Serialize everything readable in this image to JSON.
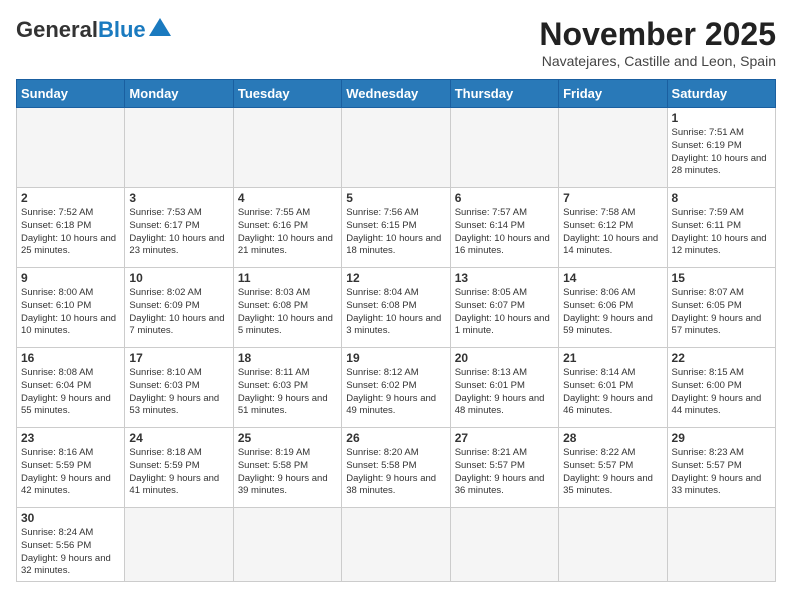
{
  "header": {
    "logo_text_general": "General",
    "logo_text_blue": "Blue",
    "month_title": "November 2025",
    "subtitle": "Navatejares, Castille and Leon, Spain"
  },
  "days_of_week": [
    "Sunday",
    "Monday",
    "Tuesday",
    "Wednesday",
    "Thursday",
    "Friday",
    "Saturday"
  ],
  "weeks": [
    [
      {
        "day": "",
        "info": ""
      },
      {
        "day": "",
        "info": ""
      },
      {
        "day": "",
        "info": ""
      },
      {
        "day": "",
        "info": ""
      },
      {
        "day": "",
        "info": ""
      },
      {
        "day": "",
        "info": ""
      },
      {
        "day": "1",
        "info": "Sunrise: 7:51 AM\nSunset: 6:19 PM\nDaylight: 10 hours and 28 minutes."
      }
    ],
    [
      {
        "day": "2",
        "info": "Sunrise: 7:52 AM\nSunset: 6:18 PM\nDaylight: 10 hours and 25 minutes."
      },
      {
        "day": "3",
        "info": "Sunrise: 7:53 AM\nSunset: 6:17 PM\nDaylight: 10 hours and 23 minutes."
      },
      {
        "day": "4",
        "info": "Sunrise: 7:55 AM\nSunset: 6:16 PM\nDaylight: 10 hours and 21 minutes."
      },
      {
        "day": "5",
        "info": "Sunrise: 7:56 AM\nSunset: 6:15 PM\nDaylight: 10 hours and 18 minutes."
      },
      {
        "day": "6",
        "info": "Sunrise: 7:57 AM\nSunset: 6:14 PM\nDaylight: 10 hours and 16 minutes."
      },
      {
        "day": "7",
        "info": "Sunrise: 7:58 AM\nSunset: 6:12 PM\nDaylight: 10 hours and 14 minutes."
      },
      {
        "day": "8",
        "info": "Sunrise: 7:59 AM\nSunset: 6:11 PM\nDaylight: 10 hours and 12 minutes."
      }
    ],
    [
      {
        "day": "9",
        "info": "Sunrise: 8:00 AM\nSunset: 6:10 PM\nDaylight: 10 hours and 10 minutes."
      },
      {
        "day": "10",
        "info": "Sunrise: 8:02 AM\nSunset: 6:09 PM\nDaylight: 10 hours and 7 minutes."
      },
      {
        "day": "11",
        "info": "Sunrise: 8:03 AM\nSunset: 6:08 PM\nDaylight: 10 hours and 5 minutes."
      },
      {
        "day": "12",
        "info": "Sunrise: 8:04 AM\nSunset: 6:08 PM\nDaylight: 10 hours and 3 minutes."
      },
      {
        "day": "13",
        "info": "Sunrise: 8:05 AM\nSunset: 6:07 PM\nDaylight: 10 hours and 1 minute."
      },
      {
        "day": "14",
        "info": "Sunrise: 8:06 AM\nSunset: 6:06 PM\nDaylight: 9 hours and 59 minutes."
      },
      {
        "day": "15",
        "info": "Sunrise: 8:07 AM\nSunset: 6:05 PM\nDaylight: 9 hours and 57 minutes."
      }
    ],
    [
      {
        "day": "16",
        "info": "Sunrise: 8:08 AM\nSunset: 6:04 PM\nDaylight: 9 hours and 55 minutes."
      },
      {
        "day": "17",
        "info": "Sunrise: 8:10 AM\nSunset: 6:03 PM\nDaylight: 9 hours and 53 minutes."
      },
      {
        "day": "18",
        "info": "Sunrise: 8:11 AM\nSunset: 6:03 PM\nDaylight: 9 hours and 51 minutes."
      },
      {
        "day": "19",
        "info": "Sunrise: 8:12 AM\nSunset: 6:02 PM\nDaylight: 9 hours and 49 minutes."
      },
      {
        "day": "20",
        "info": "Sunrise: 8:13 AM\nSunset: 6:01 PM\nDaylight: 9 hours and 48 minutes."
      },
      {
        "day": "21",
        "info": "Sunrise: 8:14 AM\nSunset: 6:01 PM\nDaylight: 9 hours and 46 minutes."
      },
      {
        "day": "22",
        "info": "Sunrise: 8:15 AM\nSunset: 6:00 PM\nDaylight: 9 hours and 44 minutes."
      }
    ],
    [
      {
        "day": "23",
        "info": "Sunrise: 8:16 AM\nSunset: 5:59 PM\nDaylight: 9 hours and 42 minutes."
      },
      {
        "day": "24",
        "info": "Sunrise: 8:18 AM\nSunset: 5:59 PM\nDaylight: 9 hours and 41 minutes."
      },
      {
        "day": "25",
        "info": "Sunrise: 8:19 AM\nSunset: 5:58 PM\nDaylight: 9 hours and 39 minutes."
      },
      {
        "day": "26",
        "info": "Sunrise: 8:20 AM\nSunset: 5:58 PM\nDaylight: 9 hours and 38 minutes."
      },
      {
        "day": "27",
        "info": "Sunrise: 8:21 AM\nSunset: 5:57 PM\nDaylight: 9 hours and 36 minutes."
      },
      {
        "day": "28",
        "info": "Sunrise: 8:22 AM\nSunset: 5:57 PM\nDaylight: 9 hours and 35 minutes."
      },
      {
        "day": "29",
        "info": "Sunrise: 8:23 AM\nSunset: 5:57 PM\nDaylight: 9 hours and 33 minutes."
      }
    ],
    [
      {
        "day": "30",
        "info": "Sunrise: 8:24 AM\nSunset: 5:56 PM\nDaylight: 9 hours and 32 minutes."
      },
      {
        "day": "",
        "info": ""
      },
      {
        "day": "",
        "info": ""
      },
      {
        "day": "",
        "info": ""
      },
      {
        "day": "",
        "info": ""
      },
      {
        "day": "",
        "info": ""
      },
      {
        "day": "",
        "info": ""
      }
    ]
  ]
}
